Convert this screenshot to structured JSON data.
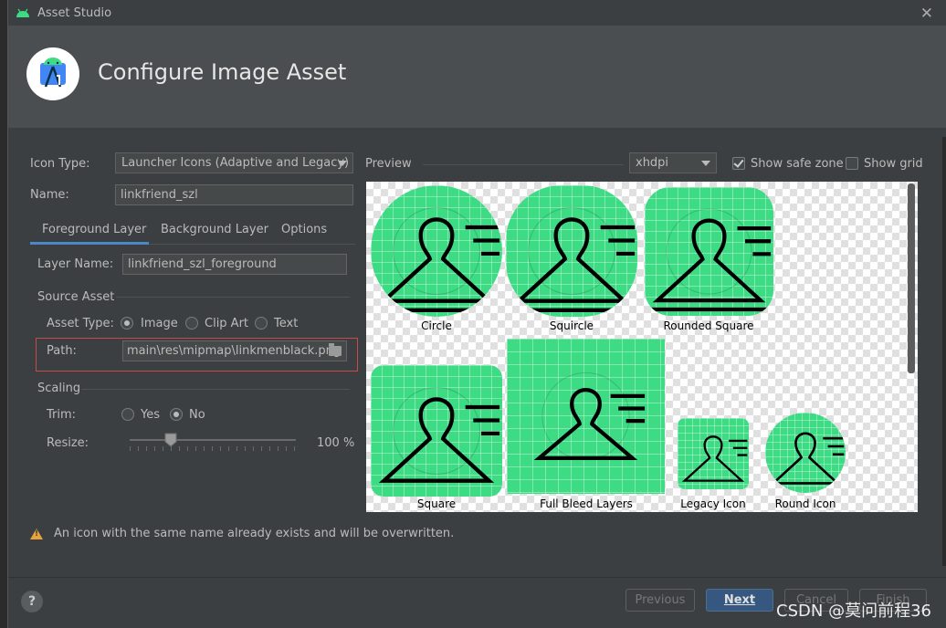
{
  "window": {
    "title": "Asset Studio",
    "header_title": "Configure Image Asset"
  },
  "form": {
    "icon_type_label": "Icon Type:",
    "icon_type_value": "Launcher Icons (Adaptive and Legacy)",
    "name_label": "Name:",
    "name_value": "linkfriend_szl"
  },
  "tabs": [
    {
      "label": "Foreground Layer",
      "active": true
    },
    {
      "label": "Background Layer",
      "active": false
    },
    {
      "label": "Options",
      "active": false
    }
  ],
  "foreground": {
    "layer_name_label": "Layer Name:",
    "layer_name_value": "linkfriend_szl_foreground",
    "source_asset_heading": "Source Asset",
    "asset_type_label": "Asset Type:",
    "asset_type_options": [
      "Image",
      "Clip Art",
      "Text"
    ],
    "asset_type_selected": "Image",
    "path_label": "Path:",
    "path_value": "main\\res\\mipmap\\linkmenblack.png",
    "scaling_heading": "Scaling",
    "trim_label": "Trim:",
    "trim_options": [
      "Yes",
      "No"
    ],
    "trim_selected": "No",
    "resize_label": "Resize:",
    "resize_value": "100 %",
    "resize_percent": 100
  },
  "preview": {
    "label": "Preview",
    "density": "xhdpi",
    "show_safe_zone_label": "Show safe zone",
    "show_safe_zone": true,
    "show_grid_label": "Show grid",
    "show_grid": false,
    "icons": [
      "Circle",
      "Squircle",
      "Rounded Square",
      "Square",
      "Full Bleed Layers",
      "Legacy Icon",
      "Round Icon"
    ]
  },
  "warning": "An icon with the same name already exists and will be overwritten.",
  "buttons": {
    "help": "?",
    "previous": "Previous",
    "next": "Next",
    "cancel": "Cancel",
    "finish": "Finish"
  },
  "watermark": "CSDN @莫问前程36",
  "colors": {
    "accent": "#4a88c7",
    "icon_bg": "#3ddc84",
    "warning": "#e8a33d",
    "error_outline": "#c44c4c"
  }
}
